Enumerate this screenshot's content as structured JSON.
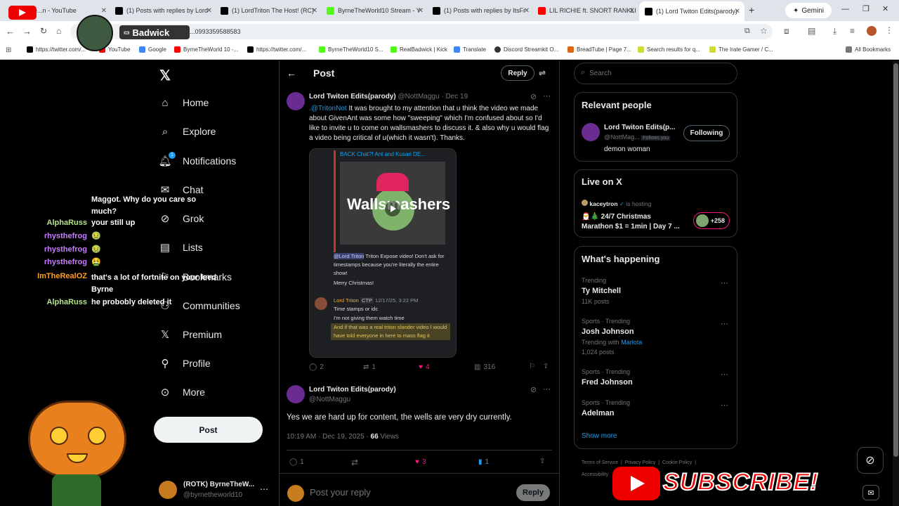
{
  "browser": {
    "tabs": [
      {
        "title": "ishRe...n - YouTube",
        "color": "#ff0000"
      },
      {
        "title": "(1) Posts with replies by Lord",
        "color": "#000000"
      },
      {
        "title": "(1) LordTriton The Host! (RC)",
        "color": "#000000"
      },
      {
        "title": "ByrneTheWorld10 Stream - Y",
        "color": "#53fc18"
      },
      {
        "title": "(1) Posts with replies by ItsFr",
        "color": "#000000"
      },
      {
        "title": "LIL RICHIE ft. SNORT RANKLI",
        "color": "#ff0000"
      },
      {
        "title": "(1) Lord Twiton Edits(parody)",
        "color": "#000000"
      }
    ],
    "new_tab": "+",
    "gemini": "Gemini",
    "url": "...0993359588583",
    "bookmarks": [
      "https://twitter.com/...",
      "YouTube",
      "Google",
      "ByrneTheWorld 10 -...",
      "https://twitter.com/...",
      "ByrneTheWorld10 S...",
      "RealBadwick | Kick",
      "Translate",
      "Discord Streamkit O...",
      "BreadTube | Page 7...",
      "Search results for q...",
      "The Irate Gamer / C..."
    ],
    "all_bookmarks": "All Bookmarks"
  },
  "overlay": {
    "streamer": "Badwick",
    "chat": [
      {
        "name": "",
        "text": "Maggot. Why do you care so much?",
        "color": "#ffffff"
      },
      {
        "name": "AlphaRuss",
        "text": "your still up",
        "color": "#b5e48c"
      },
      {
        "name": "rhysthefrog",
        "text": "🤢",
        "color": "#c77dff"
      },
      {
        "name": "rhysthefrog",
        "text": "🤢",
        "color": "#c77dff"
      },
      {
        "name": "rhysthefrog",
        "text": "🤮",
        "color": "#c77dff"
      },
      {
        "name": "ImTheRealOZ",
        "text": "that's a lot of fortnite on your feed Byrne",
        "color": "#ff9f1c"
      },
      {
        "name": "AlphaRuss",
        "text": "he probobly deleted it",
        "color": "#b5e48c"
      }
    ],
    "subscribe": "SUBSCRIBE!"
  },
  "nav": {
    "items": [
      "Home",
      "Explore",
      "Notifications",
      "Chat",
      "Grok",
      "Lists",
      "Bookmarks",
      "Communities",
      "Premium",
      "Profile",
      "More"
    ],
    "notif_badge": "1",
    "post_button": "Post",
    "account_name": "(ROTK) ByrneTheW...",
    "account_handle": "@byrnetheworld10"
  },
  "post": {
    "title": "Post",
    "reply_button": "Reply",
    "parent": {
      "name": "Lord Twiton Edits(parody)",
      "handle": "@NottMaggu",
      "date": "· Dec 19",
      "mention": ".@TritonNot",
      "text": " It was brought to my attention that u think the video we made about GivenAnt was some how \"sweeping\" which I'm confused about so I'd like to invite u to come on wallsmashers to discuss it. & also why u would flag a video being critical of u(which it wasn't).  Thanks.",
      "embed": {
        "video_title": "BACK Chat?! Ant and Kusari DE...",
        "thumb_text": "Wallsmashers",
        "mention": "@Lord Triton",
        "msg1": " Triton Expose video! Don't ask for timestamps because you're literally the entire show!",
        "msg2": "Merry Christmas!",
        "reply_name": "Lord Triton",
        "reply_tag": "CTP",
        "reply_time": "12/17/25, 3:22 PM",
        "reply1": "Time stamps or idc",
        "reply2": "I'm not giving them watch time",
        "reply3": "And if that was a real triton slander video I would have told everyone in here to mass flag it"
      },
      "replies": "2",
      "reposts": "1",
      "likes": "4",
      "views": "316"
    },
    "main": {
      "name": "Lord Twiton Edits(parody)",
      "handle": "@NottMaggu",
      "text": "Yes we are hard up for content, the wells are very dry currently.",
      "timestamp": "10:19 AM · Dec 19, 2025 · ",
      "views_count": "66",
      "views_label": " Views",
      "replies": "1",
      "likes": "3",
      "bookmarks": "1"
    },
    "reply_placeholder": "Post your reply",
    "reply_submit": "Reply"
  },
  "sidebar": {
    "search_placeholder": "Search",
    "relevant_title": "Relevant people",
    "person": {
      "name": "Lord Twiton Edits(p...",
      "handle": "@NottMag...",
      "follows_you": "Follows you",
      "bio": "demon woman",
      "button": "Following"
    },
    "live_title": "Live on X",
    "live": {
      "host": "kaceytron",
      "hosting": "is hosting",
      "title": "🎅🎄 24/7 Christmas Marathon $1 = 1min | Day 7 ...",
      "count": "+258"
    },
    "happening_title": "What's happening",
    "trends": [
      {
        "context": "Trending",
        "name": "Ty Mitchell",
        "meta": "11K posts",
        "with": "",
        "with_link": ""
      },
      {
        "context": "Sports · Trending",
        "name": "Josh Johnson",
        "meta": "1,024 posts",
        "with": "Trending with ",
        "with_link": "Marlota"
      },
      {
        "context": "Sports · Trending",
        "name": "Fred Johnson",
        "meta": "",
        "with": "",
        "with_link": ""
      },
      {
        "context": "Sports · Trending",
        "name": "Adelman",
        "meta": "",
        "with": "",
        "with_link": ""
      }
    ],
    "show_more": "Show more",
    "footer": [
      "Terms of Service",
      "Privacy Policy",
      "Cookie Policy",
      "Accessibility"
    ]
  }
}
